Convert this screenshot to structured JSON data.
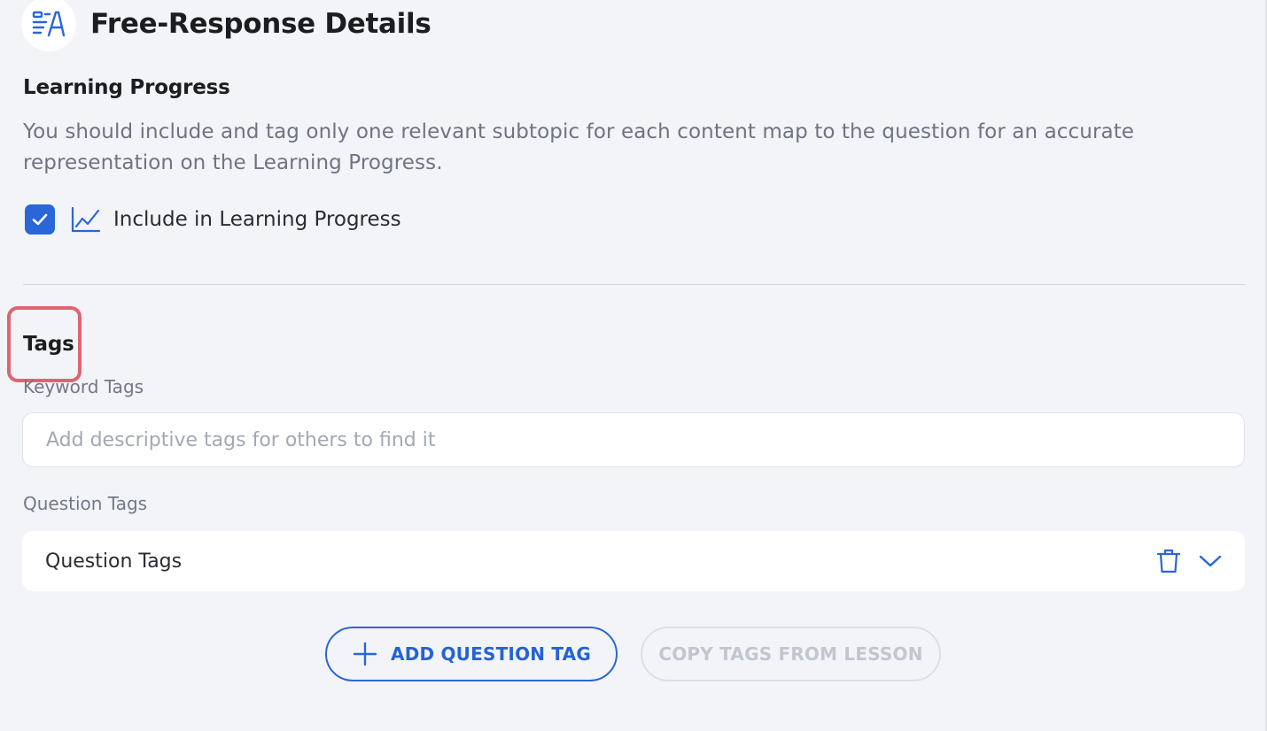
{
  "header": {
    "icon": "free-response-icon",
    "title": "Free-Response Details"
  },
  "learning_progress": {
    "heading": "Learning Progress",
    "description": "You should include and tag only one relevant subtopic for each content map to the question for an accurate representation on the Learning Progress.",
    "checkbox": {
      "checked": true,
      "icon": "line-chart-icon",
      "label": "Include in Learning Progress"
    }
  },
  "tags": {
    "heading": "Tags",
    "keyword_tags": {
      "label": "Keyword Tags",
      "value": "",
      "placeholder": "Add descriptive tags for others to find it"
    },
    "question_tags": {
      "label": "Question Tags",
      "selected": "Question Tags",
      "icons": [
        "trash-icon",
        "chevron-down-icon"
      ]
    },
    "buttons": {
      "add_question_tag": "ADD QUESTION TAG",
      "copy_tags_from_lesson": "COPY TAGS FROM LESSON"
    }
  },
  "colors": {
    "accent": "#2966d8",
    "highlight": "#e06470",
    "background": "#f3f4f8",
    "muted_text": "#6e7482",
    "disabled": "#c2c6ce"
  }
}
